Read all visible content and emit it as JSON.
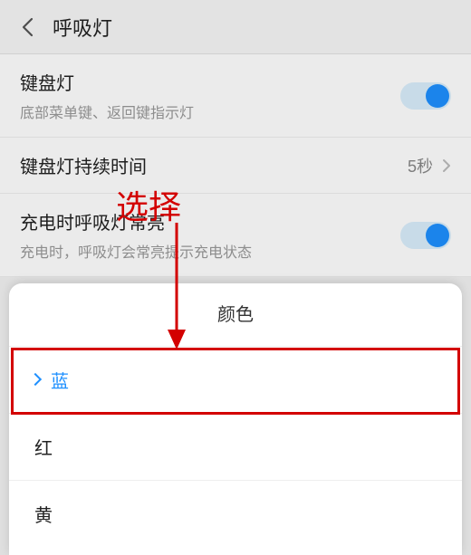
{
  "header": {
    "title": "呼吸灯"
  },
  "rows": {
    "keyboard_light": {
      "label": "键盘灯",
      "sub": "底部菜单键、返回键指示灯",
      "on": true
    },
    "keyboard_duration": {
      "label": "键盘灯持续时间",
      "value": "5秒"
    },
    "charge_breath": {
      "label": "充电时呼吸灯常亮",
      "sub": "充电时，呼吸灯会常亮提示充电状态",
      "on": true
    }
  },
  "sheet": {
    "title": "颜色",
    "options": [
      {
        "label": "蓝",
        "selected": true
      },
      {
        "label": "红",
        "selected": false
      },
      {
        "label": "黄",
        "selected": false
      }
    ]
  },
  "annotation": {
    "text": "选择"
  },
  "colors": {
    "accent": "#1e90ff",
    "annot": "#d30000"
  }
}
